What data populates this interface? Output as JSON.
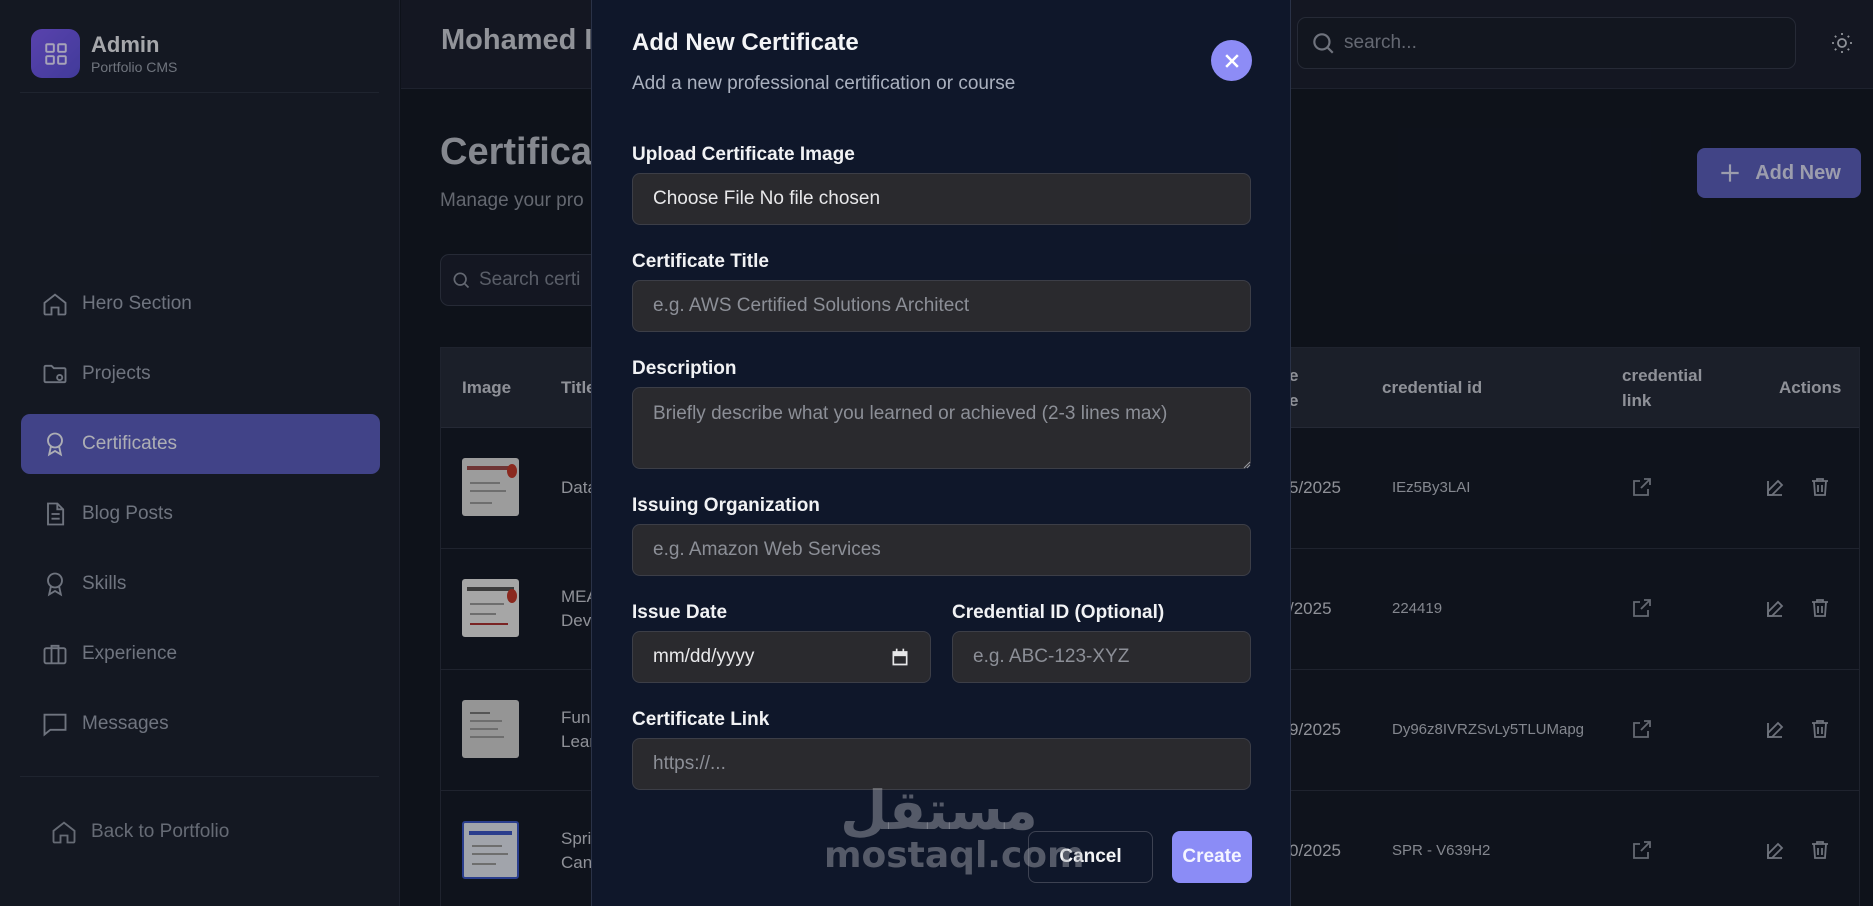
{
  "brand": {
    "title": "Admin",
    "subtitle": "Portfolio CMS"
  },
  "sidebar": {
    "items": [
      {
        "label": "Hero Section",
        "icon": "home-icon",
        "active": false
      },
      {
        "label": "Projects",
        "icon": "folder-icon",
        "active": false
      },
      {
        "label": "Certificates",
        "icon": "award-icon",
        "active": true
      },
      {
        "label": "Blog Posts",
        "icon": "document-icon",
        "active": false
      },
      {
        "label": "Skills",
        "icon": "award-icon",
        "active": false
      },
      {
        "label": "Experience",
        "icon": "briefcase-icon",
        "active": false
      },
      {
        "label": "Messages",
        "icon": "message-icon",
        "active": false
      }
    ],
    "back_label": "Back to Portfolio"
  },
  "topbar": {
    "user_name": "Mohamed I",
    "search_placeholder": "search..."
  },
  "main": {
    "title": "Certificat",
    "subtitle": "Manage your pro",
    "add_new_label": "Add New",
    "search_placeholder": "Search certi"
  },
  "table": {
    "headers": {
      "image": "Image",
      "title": "Title",
      "issue_date_1": "e",
      "issue_date_2": "e",
      "credential_id": "credential id",
      "credential_link_1": "credential",
      "credential_link_2": "link",
      "actions": "Actions"
    },
    "rows": [
      {
        "title_1": "Data",
        "title_2": "",
        "date": "5/2025",
        "credential_id": "IEz5By3LAI"
      },
      {
        "title_1": "MEA",
        "title_2": "Dev",
        "date": "/2025",
        "credential_id": "224419"
      },
      {
        "title_1": "Fun",
        "title_2": "Lear",
        "date": "9/2025",
        "credential_id": "Dy96z8IVRZSvLy5TLUMapg"
      },
      {
        "title_1": "Spri",
        "title_2": "Can",
        "date": "0/2025",
        "credential_id": "SPR - V639H2"
      }
    ]
  },
  "modal": {
    "title": "Add New Certificate",
    "subtitle": "Add a new professional certification or course",
    "upload_label": "Upload Certificate Image",
    "upload_value": "Choose File No file chosen",
    "title_label": "Certificate Title",
    "title_placeholder": "e.g. AWS Certified Solutions Architect",
    "description_label": "Description",
    "description_placeholder": "Briefly describe what you learned or achieved (2-3 lines max)",
    "org_label": "Issuing Organization",
    "org_placeholder": "e.g. Amazon Web Services",
    "issue_date_label": "Issue Date",
    "issue_date_value": "mm/dd/yyyy",
    "credential_label": "Credential ID (Optional)",
    "credential_placeholder": "e.g. ABC-123-XYZ",
    "link_label": "Certificate Link",
    "link_placeholder": "https://...",
    "cancel_label": "Cancel",
    "create_label": "Create"
  },
  "watermark": {
    "arabic": "مستقل",
    "latin": "mostaql.com"
  },
  "colors": {
    "accent": "#5a5ebd",
    "modal_bg": "#0f172a",
    "create_btn": "#8b8cf6"
  }
}
